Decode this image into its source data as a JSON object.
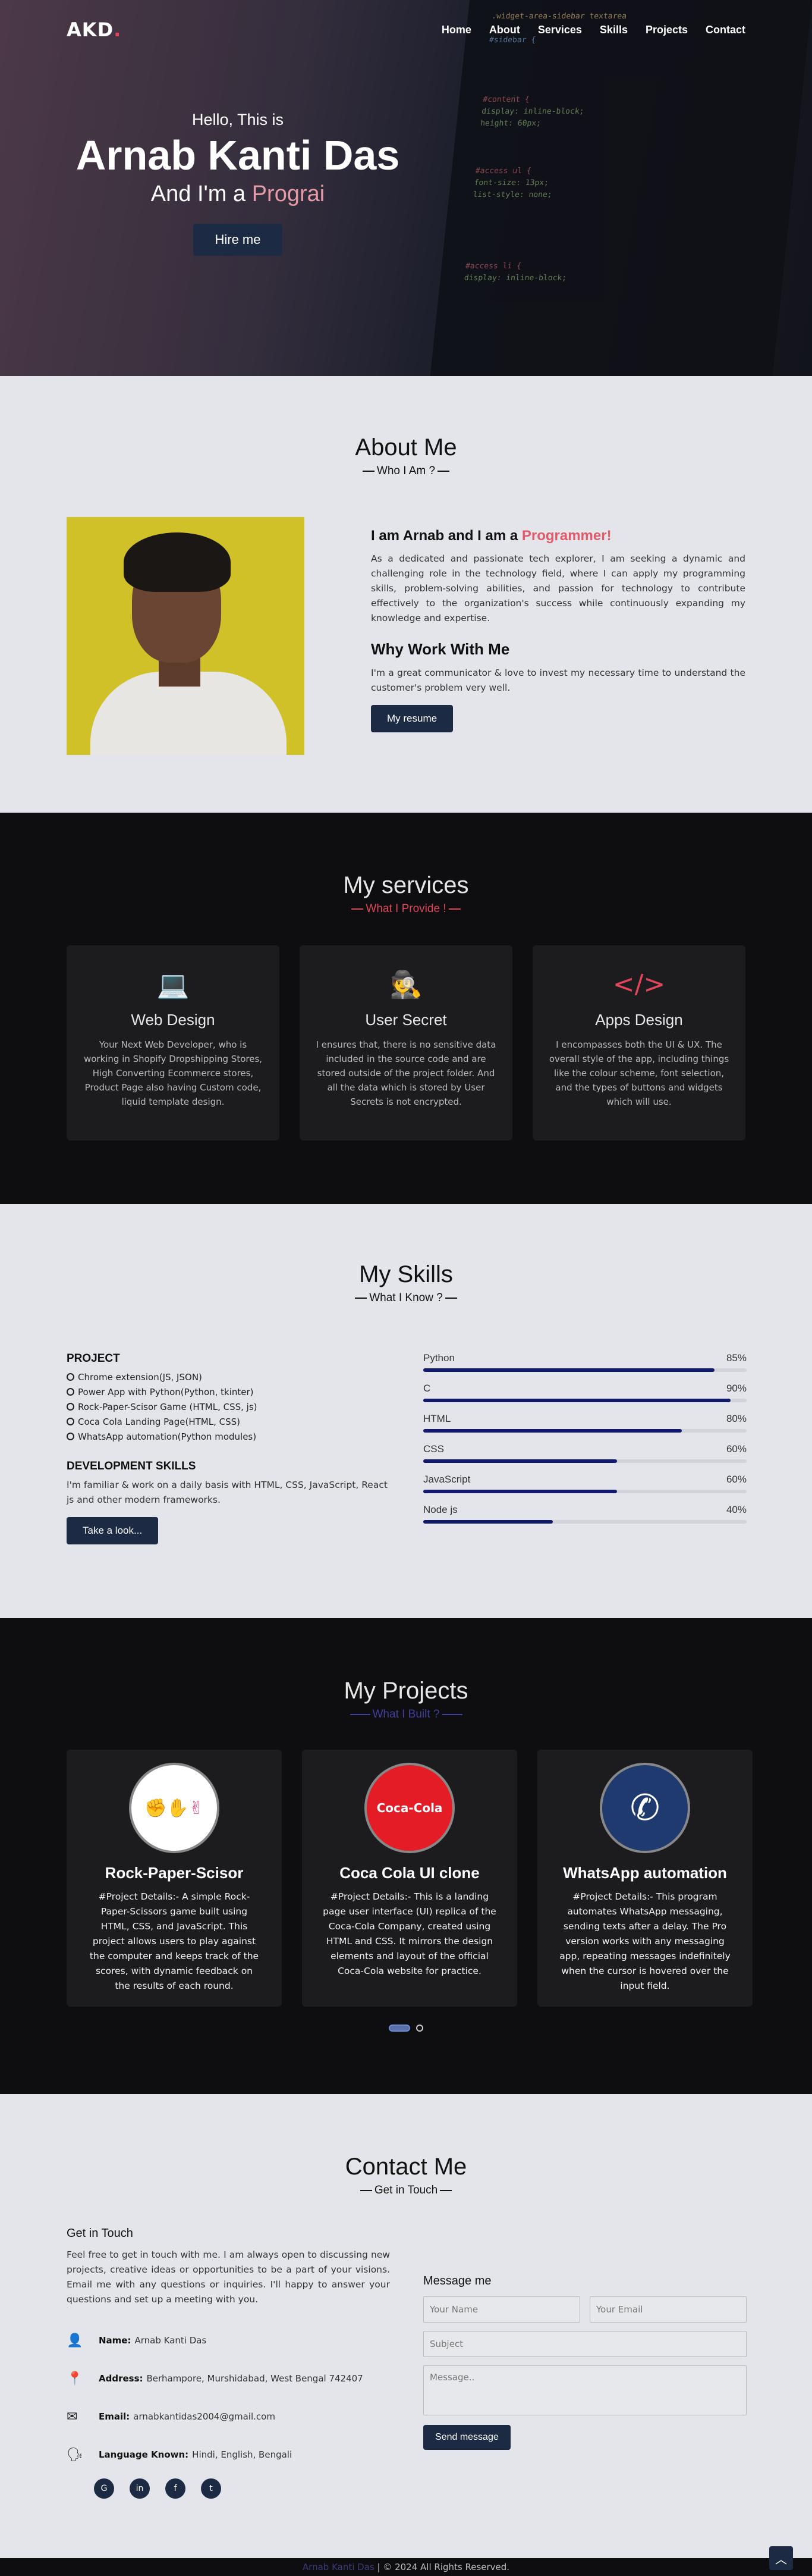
{
  "nav": {
    "logo_main": "AKD",
    "logo_dot": ".",
    "links": [
      "Home",
      "About",
      "Services",
      "Skills",
      "Projects",
      "Contact"
    ]
  },
  "hero": {
    "hello": "Hello, This is",
    "name": "Arnab Kanti Das",
    "role_prefix": "And I'm a ",
    "role_typed": "Prograi",
    "button": "Hire me"
  },
  "about": {
    "title": "About Me",
    "subtitle": "Who I Am ?",
    "heading_prefix": "I am Arnab and I am a ",
    "heading_typed": "Programmer!",
    "paragraph": "As a dedicated and passionate tech explorer, I am seeking a dynamic and challenging role in the technology field, where I can apply my programming skills, problem-solving abilities, and passion for technology to contribute effectively to the organization's success while continuously expanding my knowledge and expertise.",
    "why_heading": "Why Work With Me",
    "why_text": "I'm a great communicator & love to invest my necessary time to understand the customer's problem very well.",
    "button": "My resume"
  },
  "services": {
    "title": "My services",
    "subtitle": "What I Provide !",
    "items": [
      {
        "icon": "laptop-code-icon",
        "glyph": "💻",
        "title": "Web Design",
        "text": "Your Next Web Developer, who is working in Shopify Dropshipping Stores, High Converting Ecommerce stores, Product Page also having Custom code, liquid template design."
      },
      {
        "icon": "user-secret-icon",
        "glyph": "🕵",
        "title": "User Secret",
        "text": "I ensures that, there is no sensitive data included in the source code and are stored outside of the project folder. And all the data which is stored by User Secrets is not encrypted."
      },
      {
        "icon": "code-icon",
        "glyph": "</>",
        "title": "Apps Design",
        "text": "I encompasses both the UI & UX. The overall style of the app, including things like the colour scheme, font selection, and the types of buttons and widgets which will use."
      }
    ]
  },
  "skills": {
    "title": "My Skills",
    "subtitle": "What I Know ?",
    "project_heading": "PROJECT",
    "projects": [
      "Chrome extension(JS, JSON)",
      "Power App with Python(Python, tkinter)",
      "Rock-Paper-Scisor Game (HTML, CSS, js)",
      "Coca Cola Landing Page(HTML, CSS)",
      "WhatsApp automation(Python modules)"
    ],
    "dev_heading": "DEVELOPMENT SKILLS",
    "dev_text": "I'm familiar & work on a daily basis with HTML, CSS, JavaScript, React js and other modern frameworks.",
    "button": "Take a look...",
    "bars": [
      {
        "name": "Python",
        "percent_label": "85%",
        "value": 0.9
      },
      {
        "name": "C",
        "percent_label": "90%",
        "value": 0.95
      },
      {
        "name": "HTML",
        "percent_label": "80%",
        "value": 0.8
      },
      {
        "name": "CSS",
        "percent_label": "60%",
        "value": 0.6
      },
      {
        "name": "JavaScript",
        "percent_label": "60%",
        "value": 0.6
      },
      {
        "name": "Node js",
        "percent_label": "40%",
        "value": 0.4
      }
    ]
  },
  "projects": {
    "title": "My Projects",
    "subtitle": "What I Built ?",
    "items": [
      {
        "icon": "rock-paper-scissors-icon",
        "title": "Rock-Paper-Scisor",
        "text": "#Project Details:- A simple Rock-Paper-Scissors game built using HTML, CSS, and JavaScript. This project allows users to play against the computer and keeps track of the scores, with dynamic feedback on the results of each round.",
        "bg": "#ffffff",
        "fg": "#e5487f",
        "logo": "✊✋✌"
      },
      {
        "icon": "coca-cola-logo-icon",
        "title": "Coca Cola UI clone",
        "text": "#Project Details:- This is a landing page user interface (UI) replica of the Coca-Cola Company, created using HTML and CSS. It mirrors the design elements and layout of the official Coca-Cola website for practice.",
        "bg": "#e41c26",
        "fg": "#ffffff",
        "logo": "Coca-Cola"
      },
      {
        "icon": "whatsapp-icon",
        "title": "WhatsApp automation",
        "text": "#Project Details:- This program automates WhatsApp messaging, sending texts after a delay. The Pro version works with any messaging app, repeating messages indefinitely when the cursor is hovered over the input field.",
        "bg": "#1e3a6e",
        "fg": "#ffffff",
        "logo": "✆"
      }
    ]
  },
  "contact": {
    "title": "Contact Me",
    "subtitle": "Get in Touch",
    "heading": "Get in Touch",
    "paragraph": "Feel free to get in touch with me. I am always open to discussing new projects, creative ideas or opportunities to be a part of your visions. Email me with any questions or inquiries. I'll happy to answer your questions and set up a meeting with you.",
    "info": [
      {
        "icon": "user-icon",
        "glyph": "👤",
        "label": "Name:",
        "value": "Arnab Kanti Das"
      },
      {
        "icon": "location-icon",
        "glyph": "📍",
        "label": "Address:",
        "value": "Berhampore, Murshidabad, West Bengal 742407"
      },
      {
        "icon": "envelope-icon",
        "glyph": "✉",
        "label": "Email:",
        "value": "arnabkantidas2004@gmail.com"
      },
      {
        "icon": "language-icon",
        "glyph": "🗣",
        "label": "Language Known:",
        "value": "Hindi, English, Bengali"
      }
    ],
    "socials": [
      {
        "icon": "github-icon",
        "glyph": "G"
      },
      {
        "icon": "linkedin-icon",
        "glyph": "in"
      },
      {
        "icon": "facebook-icon",
        "glyph": "f"
      },
      {
        "icon": "twitter-icon",
        "glyph": "t"
      }
    ],
    "form": {
      "heading": "Message me",
      "name_placeholder": "Your Name",
      "email_placeholder": "Your Email",
      "subject_placeholder": "Subject",
      "message_placeholder": "Message..",
      "button": "Send message"
    }
  },
  "footer": {
    "name": "Arnab Kanti Das",
    "text": " | © 2024 All Rights Reserved."
  },
  "colors": {
    "accent": "#e0455a",
    "navy": "#1d2a44",
    "bar": "#121a6e"
  }
}
